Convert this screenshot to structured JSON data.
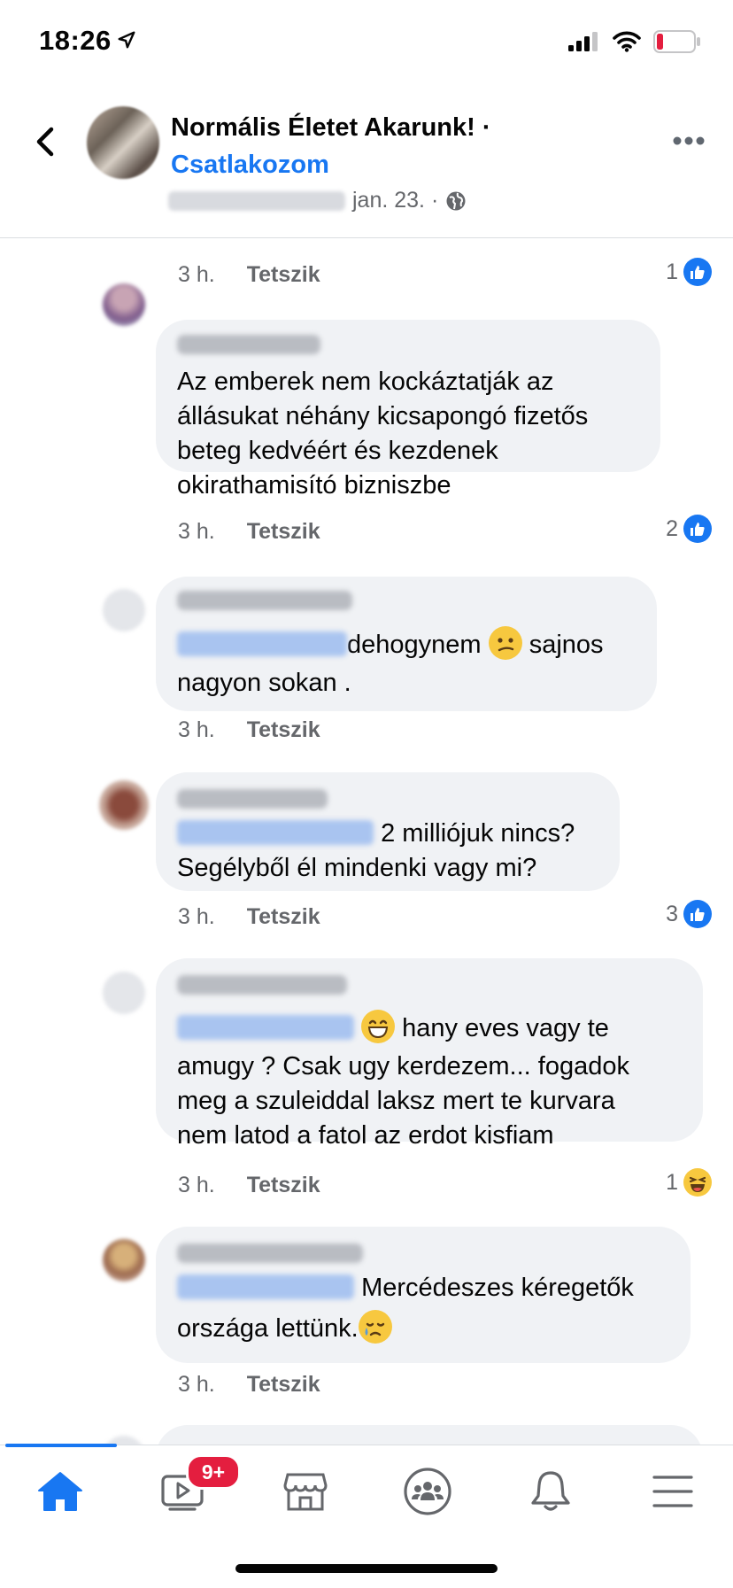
{
  "status_bar": {
    "time": "18:26"
  },
  "header": {
    "group_name": "Normális Életet Akarunk! ·",
    "join_label": "Csatlakozom",
    "date": "jan. 23. ·"
  },
  "comments": [
    {
      "time": "3 h.",
      "like_label": "Tetszik",
      "reaction_count": "1",
      "reaction": "like"
    },
    {
      "text_lines": [
        "Az emberek nem kockáztatják az",
        "állásukat néhány kicsapongó fizetős",
        "beteg kedvéért és kezdenek",
        "okirathamisító bizniszbe"
      ],
      "time": "3 h.",
      "like_label": "Tetszik",
      "reaction_count": "2",
      "reaction": "like"
    },
    {
      "text_line1": "dehogynem",
      "text_line1b": "sajnos",
      "text_line2": "nagyon sokan .",
      "time": "3 h.",
      "like_label": "Tetszik"
    },
    {
      "text_line1": "2 milliójuk nincs?",
      "text_line2": "Segélyből él mindenki vagy mi?",
      "time": "3 h.",
      "like_label": "Tetszik",
      "reaction_count": "3",
      "reaction": "like"
    },
    {
      "text_line1": "hany eves vagy te",
      "text_lines": [
        "amugy ? Csak ugy kerdezem... fogadok",
        "meg a szuleiddal laksz mert te kurvara",
        "nem latod a fatol az erdot kisfiam"
      ],
      "time": "3 h.",
      "like_label": "Tetszik",
      "reaction_count": "1",
      "reaction": "haha"
    },
    {
      "text_line1": "Mercédeszes kéregetők",
      "text_line2": "országa lettünk.",
      "time": "3 h.",
      "like_label": "Tetszik"
    }
  ],
  "bottom_nav": {
    "items": [
      "home-icon",
      "watch-icon",
      "marketplace-icon",
      "groups-icon",
      "notifications-icon",
      "menu-icon"
    ],
    "watch_badge": "9+",
    "active_color": "#1877f2"
  }
}
